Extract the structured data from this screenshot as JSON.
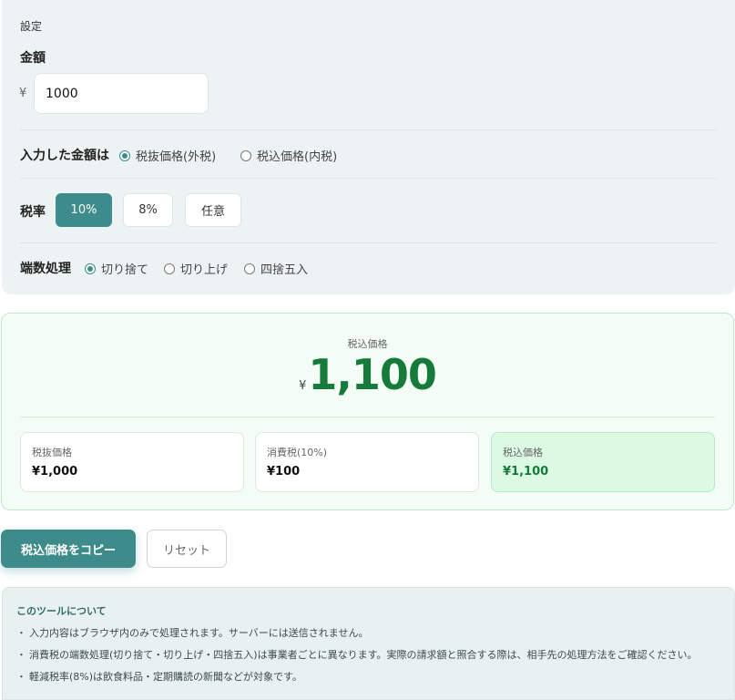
{
  "settings": {
    "section_label": "設定",
    "amount_label": "金額",
    "currency_prefix": "¥",
    "amount_value": "1000",
    "input_mode_label": "入力した金額は",
    "input_modes": [
      {
        "label": "税抜価格(外税)",
        "checked": true
      },
      {
        "label": "税込価格(内税)",
        "checked": false
      }
    ],
    "tax_rate_label": "税率",
    "tax_rates": [
      {
        "label": "10%",
        "active": true
      },
      {
        "label": "8%",
        "active": false
      },
      {
        "label": "任意",
        "active": false
      }
    ],
    "rounding_label": "端数処理",
    "rounding_options": [
      {
        "label": "切り捨て",
        "checked": true
      },
      {
        "label": "切り上げ",
        "checked": false
      },
      {
        "label": "四捨五入",
        "checked": false
      }
    ]
  },
  "result": {
    "caption": "税込価格",
    "currency": "¥",
    "value": "1,100",
    "cards": [
      {
        "label": "税抜価格",
        "value": "¥1,000"
      },
      {
        "label": "消費税(10%)",
        "value": "¥100"
      },
      {
        "label": "税込価格",
        "value": "¥1,100"
      }
    ]
  },
  "actions": {
    "copy_label": "税込価格をコピー",
    "reset_label": "リセット"
  },
  "about": {
    "title": "このツールについて",
    "bullet": "・",
    "items": [
      "入力内容はブラウザ内のみで処理されます。サーバーには送信されません。",
      "消費税の端数処理(切り捨て・切り上げ・四捨五入)は事業者ごとに異なります。実際の請求額と照合する際は、相手先の処理方法をご確認ください。",
      "軽減税率(8%)は飲食料品・定期購読の新聞などが対象です。"
    ]
  },
  "colors": {
    "accent": "#3d8c8b",
    "result_green": "#157a3a",
    "result_bg": "#f3fcf5",
    "panel_bg": "#edf2f2"
  }
}
